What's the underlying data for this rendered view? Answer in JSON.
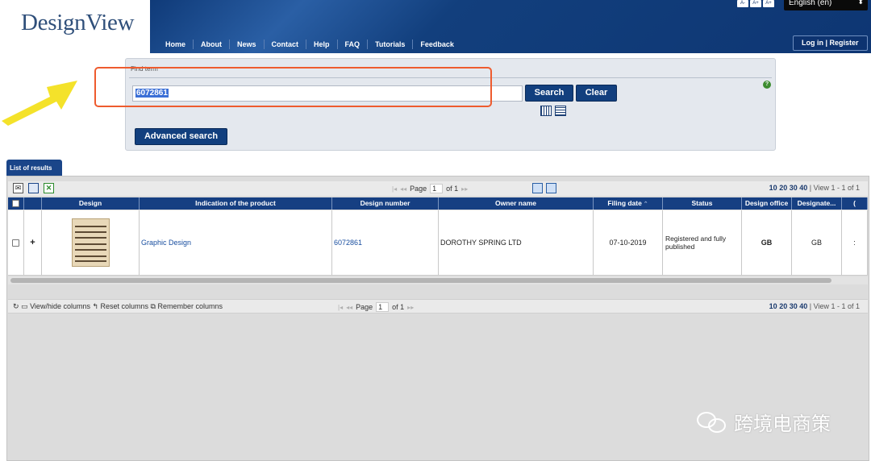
{
  "header": {
    "logo_text": "DesignView",
    "nav": [
      "Home",
      "About",
      "News",
      "Contact",
      "Help",
      "FAQ",
      "Tutorials",
      "Feedback"
    ],
    "font_size_buttons": [
      "A-",
      "A+",
      "A+"
    ],
    "language": "English (en)",
    "login_label": "Log in | Register"
  },
  "search": {
    "find_label": "Find term",
    "value": "6072861",
    "search_label": "Search",
    "clear_label": "Clear",
    "advanced_label": "Advanced search",
    "help_icon": "?"
  },
  "results": {
    "tab_label": "List of results",
    "pager": {
      "page_label": "Page",
      "page": "1",
      "of_label": "of 1"
    },
    "rows_per_page": [
      "10",
      "20",
      "30",
      "40"
    ],
    "view_text": "| View 1 - 1 of 1",
    "columns": [
      "Design",
      "Indication of the product",
      "Design number",
      "Owner name",
      "Filing date",
      "Status",
      "Design office",
      "Designate...",
      "("
    ],
    "row": {
      "expand": "+",
      "indication": "Graphic Design",
      "design_number": "6072861",
      "owner": "DOROTHY SPRING LTD",
      "filing_date": "07-10-2019",
      "status": "Registered and fully published",
      "design_office": "GB",
      "designated": "GB",
      "extra": ":"
    },
    "footer_actions": "View/hide columns  ↰ Reset columns  ⧉ Remember columns"
  },
  "watermark": "跨境电商策",
  "colors": {
    "header_blue": "#123f7e",
    "highlight_box": "#ee5b2e",
    "arrow": "#f4e22a"
  }
}
